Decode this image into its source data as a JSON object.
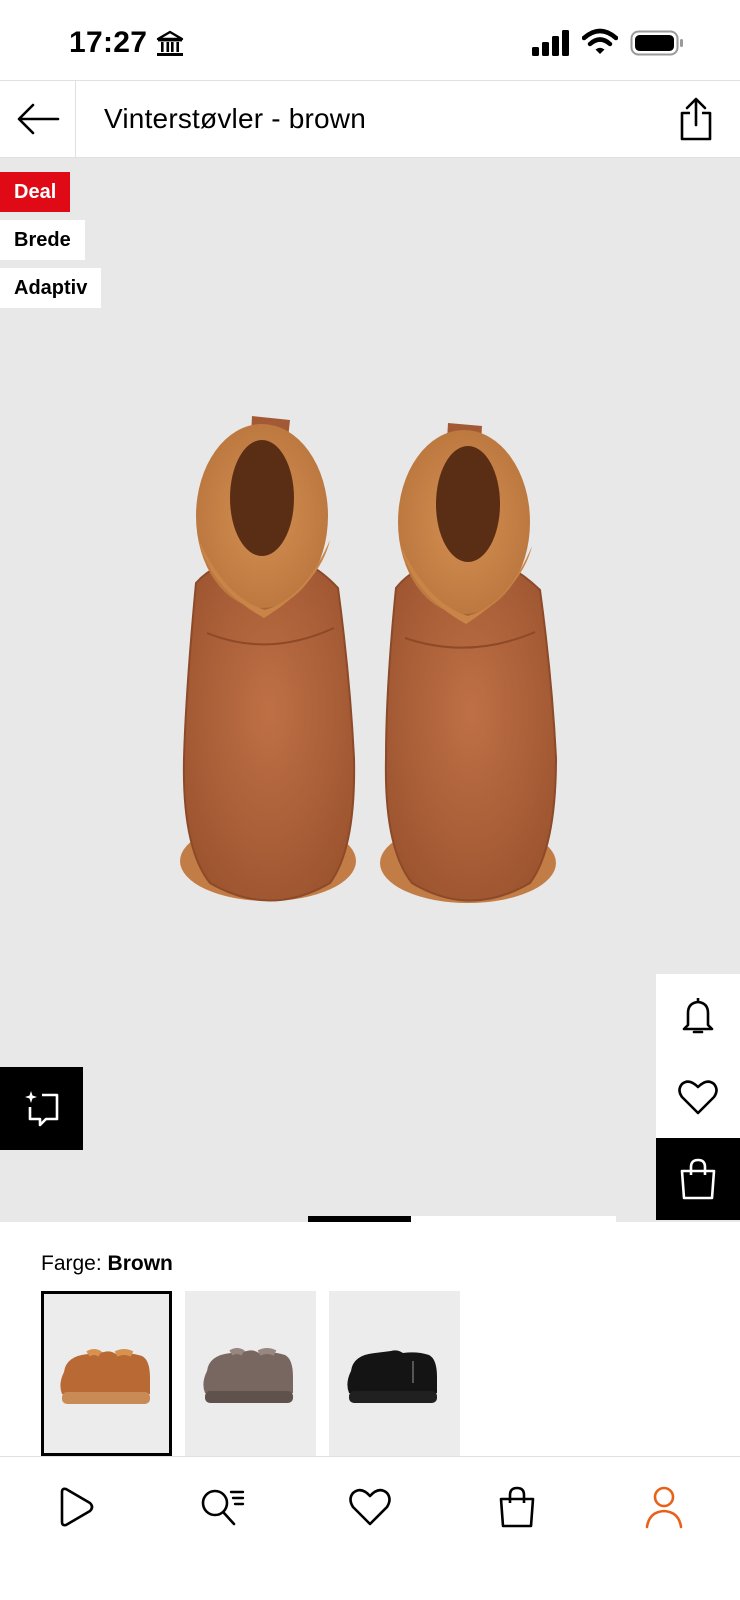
{
  "status_bar": {
    "time": "17:27",
    "icons": [
      "bank-icon",
      "signal-icon",
      "wifi-icon",
      "battery-icon"
    ]
  },
  "header": {
    "title": "Vinterstøvler - brown",
    "back_icon": "arrow-left-icon",
    "share_icon": "share-icon"
  },
  "product": {
    "tags": [
      "Deal",
      "Brede",
      "Adaptiv"
    ],
    "image_description_icon": "boots-image",
    "actions": [
      "bell-icon",
      "heart-icon",
      "shopping-bag-icon"
    ],
    "ai_icon": "ai-sparkle-icon",
    "carousel": {
      "current": 1,
      "total": 3
    }
  },
  "color": {
    "label": "Farge:",
    "selected": "Brown",
    "swatches": [
      {
        "name": "brown",
        "color": "#b9682f",
        "selected": true
      },
      {
        "name": "grey",
        "color": "#76665f",
        "selected": false
      },
      {
        "name": "black",
        "color": "#111111",
        "selected": false
      }
    ]
  },
  "bottom_nav": {
    "items": [
      "play-icon",
      "search-list-icon",
      "heart-icon",
      "bag-icon",
      "profile-icon"
    ],
    "active_color": "#e8611a"
  },
  "colors": {
    "deal_red": "#e00a17",
    "image_bg": "#e8e8e8",
    "accent_orange": "#e8611a"
  }
}
